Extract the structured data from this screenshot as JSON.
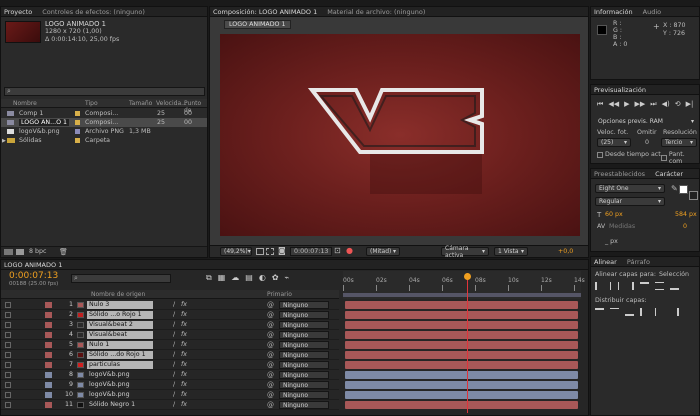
{
  "colors": {
    "playhead": "#e0343a",
    "time_orange": "#f0a020",
    "bar_red": "#a85858",
    "bar_blue": "#7e8aa6",
    "bg": "#1a1a1a"
  },
  "project": {
    "tab_label": "Proyecto",
    "tab2_label": "Controles de efectos: (ninguno)",
    "comp_name": "LOGO ANIMADO 1",
    "comp_info1": "1280 x 720 (1,00)",
    "comp_info2": "Δ 0:00:14:10, 25,00 fps",
    "search_placeholder": "",
    "columns": [
      "Nombre",
      "Tipo",
      "Tamaño",
      "Velocida...",
      "Punto de"
    ],
    "items": [
      {
        "name": "Comp 1",
        "type": "Composi...",
        "size": "",
        "fps": "25",
        "pt": "00"
      },
      {
        "name": "LOGO AN...O 1",
        "type": "Composi...",
        "size": "",
        "fps": "25",
        "pt": "00"
      },
      {
        "name": "logoV&b.png",
        "type": "Archivo PNG",
        "size": "1,3 MB",
        "fps": "",
        "pt": ""
      },
      {
        "name": "Sólidas",
        "type": "Carpeta",
        "size": "",
        "fps": "",
        "pt": ""
      }
    ],
    "bpc_label": "8 bpc"
  },
  "composition": {
    "tab_label": "Composición: LOGO ANIMADO 1",
    "tab2_label": "Material de archivo: (ninguno)",
    "subtab": "LOGO ANIMADO 1",
    "zoom": "(49,2%)",
    "timecode": "0:00:07:13",
    "resolution": "(Mitad)",
    "camera": "Cámara activa",
    "views": "1 Vista",
    "offset": "+0,0"
  },
  "info": {
    "tab_label": "Información",
    "tab2_label": "Audio",
    "r": "R :",
    "g": "G :",
    "b": "B :",
    "a": "A : 0",
    "x": "X : 870",
    "y": "Y : 726"
  },
  "preview": {
    "tab_label": "Previsualización",
    "options_label": "Opciones previs. RAM",
    "fps_label": "Veloc. fot.",
    "skip_label": "Omitir",
    "res_label": "Resolución",
    "fps_value": "(25)",
    "skip_value": "0",
    "res_value": "Tercio",
    "from_current_label": "Desde tiempo act.",
    "fullscreen_label": "Pant. com"
  },
  "character": {
    "tab1": "Preestablecidos",
    "tab2": "Carácter",
    "font": "Eight One",
    "style": "Regular",
    "size": "60 px",
    "tracking": "584 px",
    "kerning": "Medidas",
    "leading": "0",
    "baseline": "_ px"
  },
  "align": {
    "tab1": "Alinear",
    "tab2": "Párrafo",
    "align_to_label": "Alinear capas para:",
    "align_to_value": "Selección",
    "distribute_label": "Distribuir capas:"
  },
  "timeline": {
    "tab_label": "LOGO ANIMADO 1",
    "timecode": "0:00:07:13",
    "frames": "00188 (25.00 fps)",
    "col_name": "Nombre de origen",
    "col_parent": "Primario",
    "ruler": [
      "00s",
      "02s",
      "04s",
      "06s",
      "08s",
      "10s",
      "12s",
      "14s"
    ],
    "playhead_time": 7.52,
    "duration": 14.4,
    "layers": [
      {
        "num": "1",
        "name": "Nulo 3",
        "color": "#a85858",
        "swatch": "#a85858",
        "parent": "Ninguno",
        "bar": "red",
        "plain": false
      },
      {
        "num": "2",
        "name": "Sólido ...o Rojo 1",
        "color": "#a85858",
        "swatch": "#c02020",
        "parent": "Ninguno",
        "bar": "red",
        "plain": false
      },
      {
        "num": "3",
        "name": "Visual&beat 2",
        "color": "#a85858",
        "swatch": "#2a2a2a",
        "parent": "Ninguno",
        "bar": "red",
        "plain": false
      },
      {
        "num": "4",
        "name": "Visual&beat",
        "color": "#a85858",
        "swatch": "#2a2a2a",
        "parent": "Ninguno",
        "bar": "red",
        "plain": false
      },
      {
        "num": "5",
        "name": "Nulo 1",
        "color": "#a85858",
        "swatch": "#a85858",
        "parent": "Ninguno",
        "bar": "red",
        "plain": false
      },
      {
        "num": "6",
        "name": "Sólido ...do Rojo 1",
        "color": "#a85858",
        "swatch": "#5a1010",
        "parent": "Ninguno",
        "bar": "red",
        "plain": false
      },
      {
        "num": "7",
        "name": "particulas",
        "color": "#a85858",
        "swatch": "#d02020",
        "parent": "Ninguno",
        "bar": "red",
        "plain": false
      },
      {
        "num": "8",
        "name": "logoV&b.png",
        "color": "#7e8aa6",
        "swatch": "#7e8aa6",
        "parent": "Ninguno",
        "bar": "blue",
        "plain": true
      },
      {
        "num": "9",
        "name": "logoV&b.png",
        "color": "#7e8aa6",
        "swatch": "#7e8aa6",
        "parent": "Ninguno",
        "bar": "blue",
        "plain": true
      },
      {
        "num": "10",
        "name": "logoV&b.png",
        "color": "#7e8aa6",
        "swatch": "#7e8aa6",
        "parent": "Ninguno",
        "bar": "blue",
        "plain": true
      },
      {
        "num": "11",
        "name": "Sólido Negro 1",
        "color": "#a85858",
        "swatch": "#111111",
        "parent": "Ninguno",
        "bar": "red",
        "plain": true
      }
    ]
  }
}
